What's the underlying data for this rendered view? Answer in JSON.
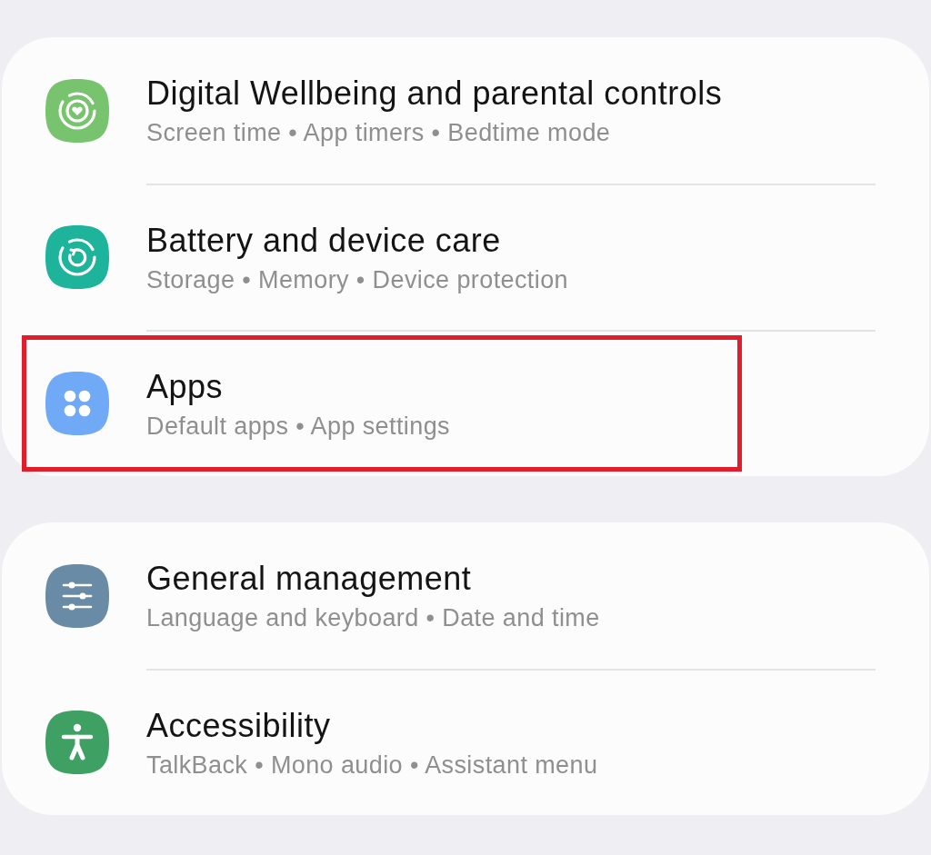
{
  "groups": [
    {
      "items": [
        {
          "kind": "wellbeing",
          "title": "Digital Wellbeing and parental controls",
          "subtitle": "Screen time • App timers • Bedtime mode",
          "color": "#78c46e",
          "highlighted": false
        },
        {
          "kind": "care",
          "title": "Battery and device care",
          "subtitle": "Storage • Memory • Device protection",
          "color": "#1db49b",
          "highlighted": false
        },
        {
          "kind": "apps",
          "title": "Apps",
          "subtitle": "Default apps • App settings",
          "color": "#70aaf6",
          "highlighted": true
        }
      ]
    },
    {
      "items": [
        {
          "kind": "general",
          "title": "General management",
          "subtitle": "Language and keyboard • Date and time",
          "color": "#6a8ba6",
          "highlighted": false
        },
        {
          "kind": "accessibility",
          "title": "Accessibility",
          "subtitle": "TalkBack • Mono audio • Assistant menu",
          "color": "#3ea163",
          "highlighted": false
        }
      ]
    }
  ]
}
